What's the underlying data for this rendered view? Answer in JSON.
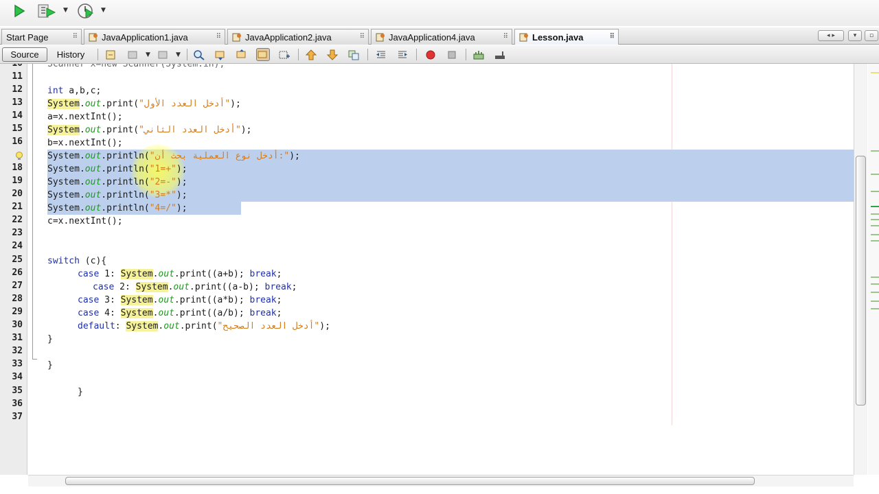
{
  "tabs": [
    {
      "label": "Start Page"
    },
    {
      "label": "JavaApplication1.java"
    },
    {
      "label": "JavaApplication2.java"
    },
    {
      "label": "JavaApplication4.java"
    },
    {
      "label": "Lesson.java"
    }
  ],
  "editor_toolbar": {
    "source_label": "Source",
    "history_label": "History"
  },
  "colors": {
    "selection": "#bcd0ee",
    "keyword": "#1f2fa8",
    "string": "#d47b1a",
    "field": "#1a9a1a",
    "class_highlight": "#f6f29a"
  },
  "code": {
    "line_numbers": [
      "11",
      "12",
      "13",
      "14",
      "15",
      "16",
      "17",
      "18",
      "19",
      "20",
      "21",
      "22",
      "23",
      "24",
      "25",
      "26",
      "27",
      "28",
      "29",
      "30",
      "31",
      "32",
      "33",
      "34",
      "35",
      "36",
      "37"
    ],
    "l10": "Scanner x=new Scanner(System.in);",
    "l12_kw": "int",
    "l12_rest": " a,b,c;",
    "sys": "System",
    "dot": ".",
    "out": "out",
    "print": ".print(",
    "println": ".println(",
    "l13_str": "\"أدخل العدد الأول\"",
    "end": ");",
    "l14": "a=x.nextInt();",
    "l15_str": "\"أدخل العدد الثاني\"",
    "l16": "b=x.nextInt();",
    "l17_str": "\"أدخل نوع العملية بحث أن:\"",
    "l18_str": "\"1=+\"",
    "l19_str": "\"2=-\"",
    "l20_str": "\"3=*\"",
    "l21_str": "\"4=/\"",
    "l22": "c=x.nextInt();",
    "l25_kw": "switch",
    "l25_rest": " (c){",
    "case_kw": "case",
    "break_kw": "break",
    "l26_lbl": " 1: ",
    "l26_arg": "(a+b); ",
    "l27_lbl": " 2: ",
    "l27_arg": "(a-b); ",
    "l28_lbl": " 3: ",
    "l28_arg": "(a*b); ",
    "l29_lbl": " 4: ",
    "l29_arg": "(a/b); ",
    "semi": ";",
    "default_kw": "default",
    "l30_lbl": ": ",
    "l30_str": "\"أدخل العدد الصحيح\"",
    "brace_close": "}"
  }
}
